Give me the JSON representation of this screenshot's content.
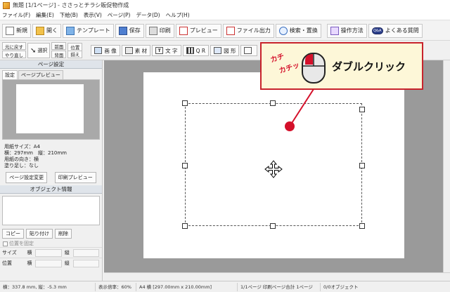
{
  "window": {
    "title": "無題 [1/1ページ] - ささっとチラシ販促物作成"
  },
  "menu": [
    "ファイル(F)",
    "編集(E)",
    "下絵(B)",
    "表示(V)",
    "ページ(P)",
    "データ(D)",
    "ヘルプ(H)"
  ],
  "toolbar1": {
    "new": "新規",
    "open": "開く",
    "template": "テンプレート",
    "save": "保存",
    "print": "印刷",
    "preview": "プレビュー",
    "file_output": "ファイル出力",
    "search_replace": "検索・置換",
    "howto": "操作方法",
    "faq": "よくある質問"
  },
  "toolbar2": {
    "undo": "元に戻す",
    "redo": "やり直し",
    "select": "選択",
    "front": "前面",
    "back": "背面",
    "align_1": "位置",
    "align_2": "揃え",
    "image": "画 像",
    "material": "素 材",
    "text": "文 字",
    "qr": "Q R",
    "shape": "図 形",
    "qa_icon": "Q&A",
    "text_icon": "T"
  },
  "left_panel": {
    "page_settings_header": "ページ設定",
    "tab_settings": "設定",
    "tab_preview": "ページプレビュー",
    "paper_size": "用紙サイズ：A4",
    "dimensions": "横：297mm　縦：210mm",
    "orientation": "用紙の向き：横",
    "bleed": "塗り足し：なし",
    "change_settings_button": "ページ設定変更",
    "print_preview_button": "印刷プレビュー",
    "object_info_header": "オブジェクト情報",
    "copy_button": "コピー",
    "paste_button": "貼り付け",
    "delete_button": "削除",
    "fix_position": "位置を固定",
    "size_label": "サイズ",
    "position_label": "位置",
    "horizontal": "横",
    "vertical": "縦"
  },
  "callout": {
    "sound_1": "カチ",
    "sound_2": "カチッ",
    "text": "ダブルクリック",
    "colors": {
      "border": "#c8232c",
      "background": "#fdf7d8",
      "accent": "#d4102a"
    }
  },
  "statusbar": {
    "coords": "横：337.8 mm, 縦：-5.3 mm",
    "zoom": "表示倍率：60%",
    "paper": "A4 横 [297.00mm x 210.00mm]",
    "pages": "1/1ページ 印刷ページ合計 1ページ",
    "objects": "0/0オブジェクト"
  }
}
